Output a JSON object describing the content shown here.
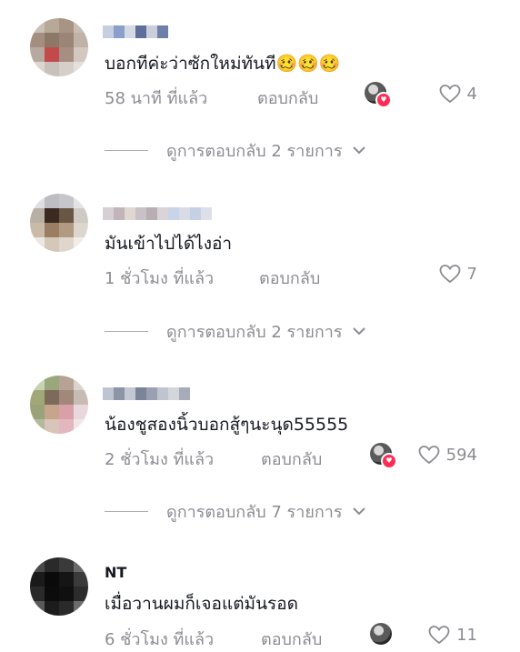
{
  "comments": [
    {
      "text": "บอกทีค่ะว่าซักใหม่ทันที🥴🥴🥴",
      "time": "58 นาที ที่แล้ว",
      "reply_label": "ตอบกลับ",
      "likes": "4",
      "creator_liked": true,
      "view_replies": "ดูการตอบกลับ 2 รายการ"
    },
    {
      "text": "มันเข้าไปได้ไงอ่า",
      "time": "1 ชั่วโมง ที่แล้ว",
      "reply_label": "ตอบกลับ",
      "likes": "7",
      "creator_liked": false,
      "view_replies": "ดูการตอบกลับ 2 รายการ"
    },
    {
      "text": "น้องชูสองนิ้วบอกสู้ๆนะนุด55555",
      "time": "2 ชั่วโมง ที่แล้ว",
      "reply_label": "ตอบกลับ",
      "likes": "594",
      "creator_liked": true,
      "view_replies": "ดูการตอบกลับ 7 รายการ"
    },
    {
      "username": "NT",
      "text": "เมื่อวานผมก็เจอแต่มันรอด",
      "time": "6 ชั่วโมง ที่แล้ว",
      "reply_label": "ตอบกลับ",
      "likes": "11",
      "creator_liked": true
    }
  ],
  "colors": {
    "text_primary": "#161823",
    "text_secondary": "rgba(22,24,35,0.5)",
    "heart_badge": "#fe2c55"
  }
}
